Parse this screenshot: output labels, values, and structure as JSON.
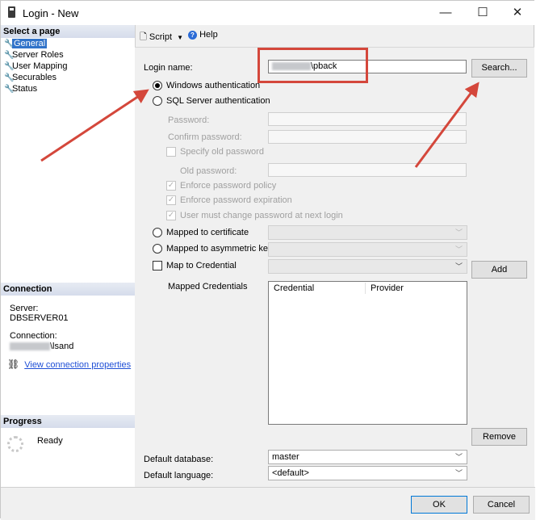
{
  "window": {
    "title": "Login - New",
    "minimize": "—",
    "maximize": "☐",
    "close": "✕"
  },
  "sidebar": {
    "select_page_title": "Select a page",
    "items": [
      {
        "label": "General",
        "icon": "wrench-icon"
      },
      {
        "label": "Server Roles",
        "icon": "wrench-icon"
      },
      {
        "label": "User Mapping",
        "icon": "wrench-icon"
      },
      {
        "label": "Securables",
        "icon": "wrench-icon"
      },
      {
        "label": "Status",
        "icon": "wrench-icon"
      }
    ],
    "connection_title": "Connection",
    "server_label": "Server:",
    "server_value": "DBSERVER01",
    "connection_label": "Connection:",
    "connection_value_suffix": "\\lsand",
    "view_props": "View connection properties",
    "progress_title": "Progress",
    "progress_status": "Ready"
  },
  "toolbar": {
    "script": "Script",
    "help": "Help"
  },
  "form": {
    "login_name_label": "Login name:",
    "login_name_value_suffix": "\\pback",
    "search_button": "Search...",
    "windows_auth": "Windows authentication",
    "sql_auth": "SQL Server authentication",
    "password": "Password:",
    "confirm_password": "Confirm password:",
    "specify_old_password": "Specify old password",
    "old_password": "Old password:",
    "enforce_policy": "Enforce password policy",
    "enforce_expiration": "Enforce password expiration",
    "must_change": "User must change password at next login",
    "mapped_certificate": "Mapped to certificate",
    "mapped_asym_key": "Mapped to asymmetric key",
    "map_credential": "Map to Credential",
    "add_button": "Add",
    "mapped_credentials": "Mapped Credentials",
    "grid_columns": [
      "Credential",
      "Provider"
    ],
    "remove_button": "Remove",
    "default_database_label": "Default database:",
    "default_database_value": "master",
    "default_language_label": "Default language:",
    "default_language_value": "<default>"
  },
  "footer": {
    "ok": "OK",
    "cancel": "Cancel"
  },
  "colors": {
    "annotation_red": "#d4473b",
    "selection_blue": "#3173c9",
    "link_blue": "#1f4fd6"
  }
}
